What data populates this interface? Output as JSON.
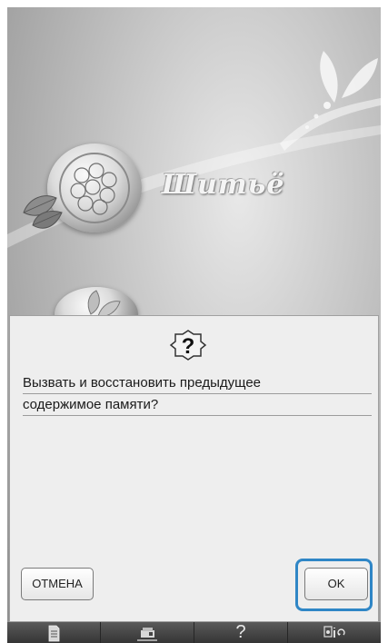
{
  "home": {
    "sewing_label": "Шитьё",
    "menu_items": [
      {
        "name": "sewing",
        "icon": "sewing-stitch-medallion-icon"
      },
      {
        "name": "embroidery",
        "icon": "embroidery-medallion-icon"
      }
    ]
  },
  "dialog": {
    "icon": "question-icon",
    "question_mark": "?",
    "message_line_1": "Вызвать и восстановить предыдущее",
    "message_line_2": "содержимое памяти?",
    "cancel_label": "ОТМЕНА",
    "ok_label": "OK"
  },
  "bottom_bar": {
    "items": [
      {
        "icon": "page-icon"
      },
      {
        "icon": "sewing-machine-icon"
      },
      {
        "icon": "help-icon",
        "label": "?"
      },
      {
        "icon": "settings-info-icon"
      }
    ]
  },
  "colors": {
    "highlight": "#2f86c6",
    "dialog_background": "#eeeeee",
    "bottom_bar": "#3f3f3f"
  }
}
